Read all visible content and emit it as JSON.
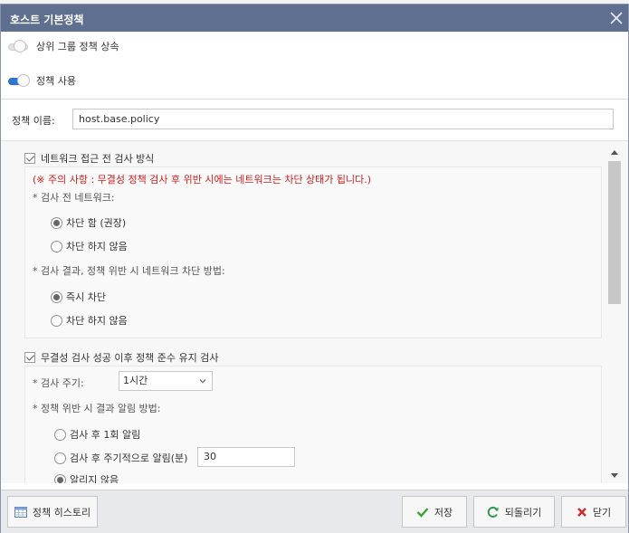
{
  "dialog": {
    "title": "호스트 기본정책"
  },
  "toggles": {
    "inherit_label": "상위 그룹 정책 상속",
    "inherit_on": false,
    "enable_label": "정책 사용",
    "enable_on": true
  },
  "policy_name": {
    "label": "정책 이름:",
    "value": "host.base.policy"
  },
  "section1": {
    "title": "네트워크 접근 전 검사 방식",
    "checked": true,
    "warning": "(※ 주의 사항 : 무결성 정책 검사 후 위반 시에는 네트워크는 차단 상태가 됩니다.)",
    "pre_check_label": "* 검사 전 네트워크:",
    "pre_check_options": [
      "차단 함 (권장)",
      "차단 하지 않음"
    ],
    "pre_check_selected": 0,
    "violation_label": "* 검사 결과, 정책 위반 시 네트워크 차단 방법:",
    "violation_options": [
      "즉시 차단",
      "차단 하지 않음"
    ],
    "violation_selected": 0
  },
  "section2": {
    "title": "무결성 검사 성공 이후 정책 준수 유지 검사",
    "checked": true,
    "cycle_label": "* 검사 주기:",
    "cycle_value": "1시간",
    "notify_label": "* 정책 위반 시 결과 알림 방법:",
    "notify_options": [
      "검사 후 1회 알림",
      "검사 후 주기적으로 알림(분)",
      "알리지 않음"
    ],
    "notify_selected": 2,
    "interval_value": "30"
  },
  "footer": {
    "history_label": "정책 히스토리",
    "save_label": "저장",
    "revert_label": "되돌리기",
    "close_label": "닫기"
  },
  "colors": {
    "titlebar": "#5f6f90",
    "warning": "#d11b1b",
    "toggle_on": "#2e77d0",
    "save_icon": "#3aa33a",
    "revert_icon": "#2f9a4a",
    "close_icon": "#d22a2a"
  },
  "icons": [
    "close-icon",
    "checkbox-icon",
    "chevron-down-icon",
    "history-icon",
    "check-icon",
    "refresh-icon",
    "x-icon",
    "scroll-up-icon",
    "scroll-down-icon"
  ]
}
